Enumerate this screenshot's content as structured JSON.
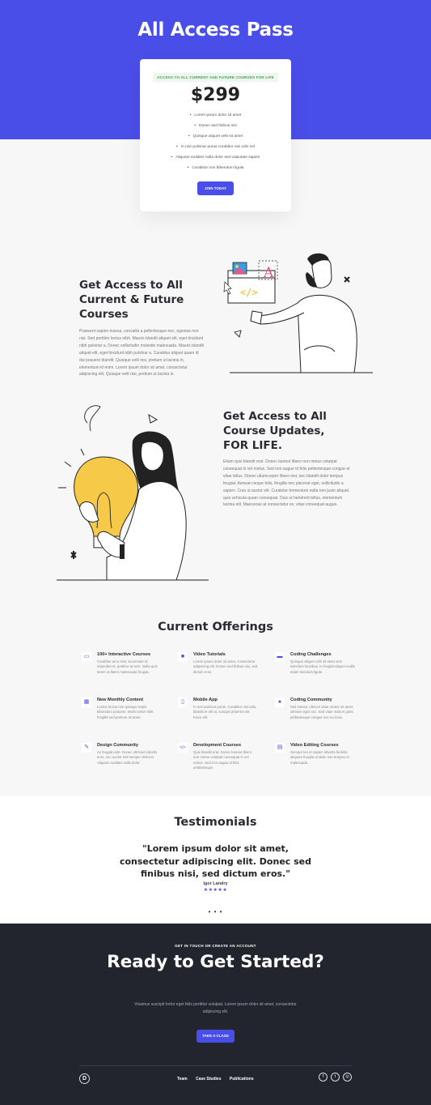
{
  "hero": {
    "title": "All Access Pass"
  },
  "pricing": {
    "tag": "ACCESS TO ALL CURRENT AND FUTURE COURSES FOR LIFE",
    "price": "$299",
    "features": [
      "Lorem ipsum dolor sit amet",
      "Donec sed finibus nisi",
      "Quisque aliquet velit sit amet",
      "In non pulvinar purus curabitur nisi odio vel",
      "Aliquam sodales nulla dolor sed vulputate sapien",
      "Curabitur non bibendum ligula"
    ],
    "button": "JOIN TODAY"
  },
  "section1": {
    "heading_lines": [
      "Get Access to All",
      "Current & Future",
      "Courses"
    ],
    "body": "Praesent sapien massa, convallis a pellentesque nec, egestas non nisi. Sed porttitor lectus nibh. Mauris blandit aliquet elit, eget tincidunt nibh pulvinar a. Donec sollicitudin molestie malesuada. Mauris blandit aliquet elit, eget tincidunt nibh pulvinar a. Curabitur aliquet quam id dui posuere blandit. Quisque velit nisi, pretium ut lacinia in, elementum id enim. Lorem ipsum dolor sit amet, consectetur adipiscing elit. Quisque velit nisi, pretium ut lacinia in."
  },
  "section2": {
    "heading_lines": [
      "Get Access to All",
      "Course Updates,",
      "FOR LIFE."
    ],
    "body": "Etiam quis blandit erat. Donec laoreet libero non metus volutpat consequat in vel metus. Sed non augue id felis pellentesque congue et vitae tellus. Donec ullamcorper libero nisl, nec blandit dolor tempus feugiat. Aenean neque felis, fringilla nec placerat eget, sollicitudin a sapien. Cras ut auctor elit. Curabitur fermentum nulla non justo aliquet, quis vehicula quam consequat. Duis ut hendrerit tellus, elementum lacinia elit. Maecenas at consectetur ex, vitae consequat augue."
  },
  "offerings": {
    "title": "Current Offerings",
    "items": [
      {
        "icon": "monitor-icon",
        "glyph": "▭",
        "name": "100+ Interactive Courses",
        "desc": "Curabitur arcu erat, accumsan id imperdiet et, porttitor at sem. Nulla quis lorem ut libero malesuada feugiat."
      },
      {
        "icon": "video-icon",
        "glyph": "■",
        "name": "Video Tutorials",
        "desc": "Lorem ipsum dolor sit amet, consectetur adipiscing elit. Donec sed finibus nisi, sed dictum eros."
      },
      {
        "icon": "laptop-icon",
        "glyph": "▬",
        "name": "Coding Challenges",
        "desc": "Quisque aliquet velit sit amet sem interdum faucibus. In feugiat aliquet mollis etiam tincidunt ligula."
      },
      {
        "icon": "calendar-icon",
        "glyph": "▦",
        "name": "New Monthly Content",
        "desc": "Luctus lectus non quisque turpis bibendum posuere. Morbi tortor nibh, fringilla sed pretium sit amet."
      },
      {
        "icon": "mobile-icon",
        "glyph": "▯",
        "name": "Mobile App",
        "desc": "In non pulvinar purus. Curabitur nisi odio, blandit et elit at, suscipit pharetra elit fusce elit."
      },
      {
        "icon": "community-icon",
        "glyph": "●",
        "name": "Coding Community",
        "desc": "Nisl massa, ultrices vitae ornare sit amet, ultricies eget orci. Sed vitae nulla et justo pellentesque congue nec eu risus."
      },
      {
        "icon": "brush-icon",
        "glyph": "✎",
        "name": "Design Community",
        "desc": "Ac feugiat ante. Donec ultricies lobortis eros, nec auctor nisl semper ultricies. Aliquam sodales nulla dolor."
      },
      {
        "icon": "code-icon",
        "glyph": "</>",
        "name": "Development Courses",
        "desc": "Quis blandit erat. Donec laoreet libero non metus volutpat consequat in vel metus. Sed non augue id felis pellentesque."
      },
      {
        "icon": "media-icon",
        "glyph": "▤",
        "name": "Video Editing Courses",
        "desc": "Semper leo et sapien lobortis facilisis aliquam feugiat ut diam non tempus et malesuada."
      }
    ]
  },
  "testimonials": {
    "title": "Testimonials",
    "quote": "\"Lorem ipsum dolor sit amet, consectetur adipiscing elit. Donec sed finibus nisi, sed dictum eros.\"",
    "author": "Igor Landry",
    "stars": "★★★★★"
  },
  "cta": {
    "eyebrow": "GET IN TOUCH OR CREATE AN ACCOUNT",
    "title": "Ready to Get Started?",
    "text": "Vivamus suscipit tortor eget felis porttitor volutpat. Lorem ipsum dolor sit amet, consectetur adipiscing elit.",
    "button": "TAKE A CLASS"
  },
  "footer": {
    "logo": "D",
    "nav": [
      "Team",
      "Case Studies",
      "Publications"
    ],
    "social": [
      {
        "icon": "facebook-icon",
        "glyph": "f"
      },
      {
        "icon": "twitter-icon",
        "glyph": "t"
      },
      {
        "icon": "instagram-icon",
        "glyph": "◎"
      }
    ]
  }
}
